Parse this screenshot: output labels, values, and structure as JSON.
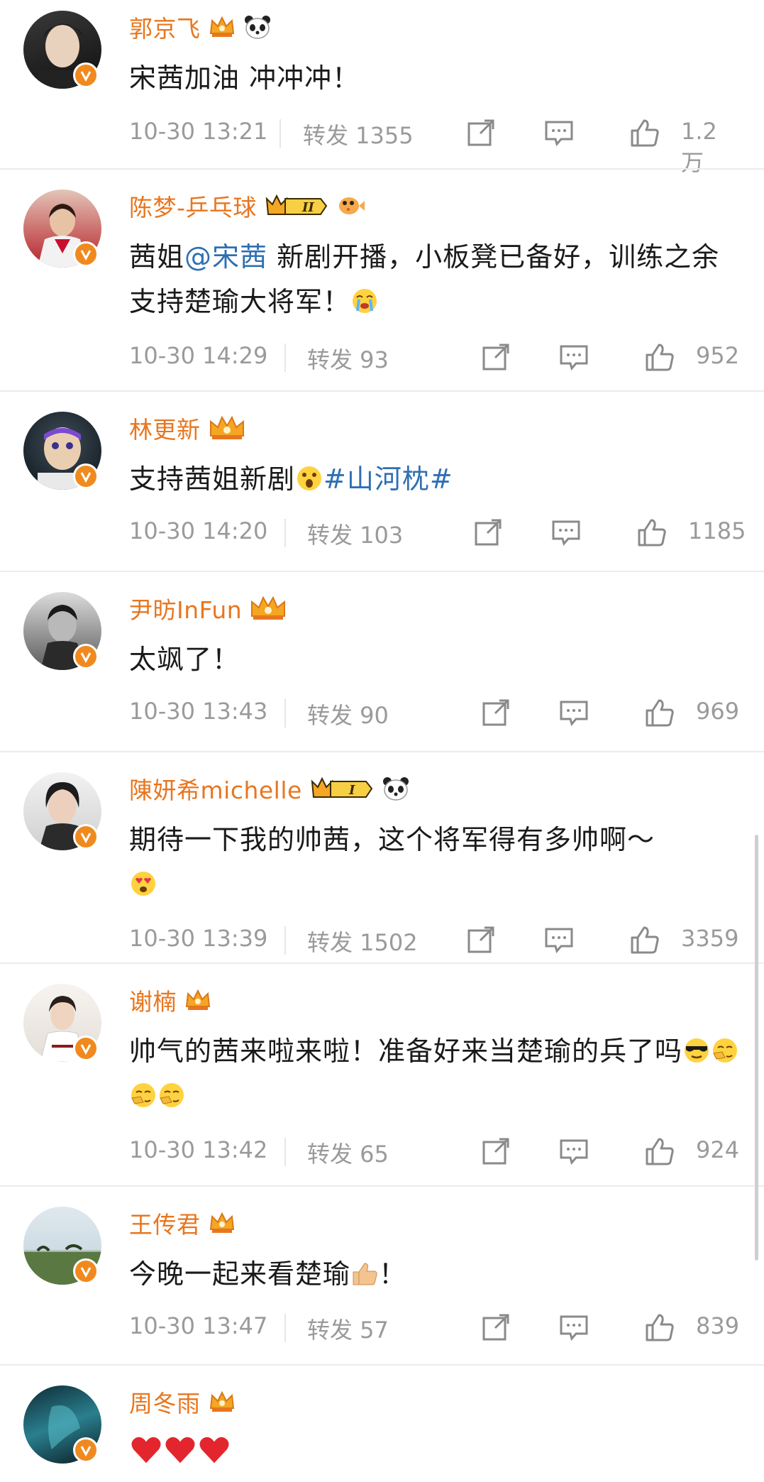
{
  "colors": {
    "name": "#e8761f",
    "link": "#2f6fb3",
    "meta": "#9a9a9a",
    "verified": "#f08a1f"
  },
  "comments": [
    {
      "name": "郭京飞",
      "badges": [
        "crown-icon",
        "panda-icon"
      ],
      "text": "宋茜加油 冲冲冲！",
      "time": "10-30 13:21",
      "repost": "转发 1355",
      "likes": "1.2万"
    },
    {
      "name": "陈梦-乒乓球",
      "badges": [
        "crown-level-badge",
        "pufferfish-icon"
      ],
      "level": "II",
      "text_parts": [
        "茜姐",
        "@宋茜",
        " 新剧开播，小板凳已备好，训练之余支持楚瑜大将军！"
      ],
      "time": "10-30 14:29",
      "repost": "转发 93",
      "likes": "952"
    },
    {
      "name": "林更新",
      "badges": [
        "crown-icon"
      ],
      "text_parts": [
        "支持茜姐新剧",
        "#山河枕#"
      ],
      "time": "10-30 14:20",
      "repost": "转发 103",
      "likes": "1185"
    },
    {
      "name": "尹昉InFun",
      "badges": [
        "crown-icon"
      ],
      "text": "太飒了！",
      "time": "10-30 13:43",
      "repost": "转发 90",
      "likes": "969"
    },
    {
      "name": "陳妍希michelle",
      "badges": [
        "crown-level-badge",
        "panda-icon"
      ],
      "level": "I",
      "text": "期待一下我的帅茜，这个将军得有多帅啊～",
      "time": "10-30 13:39",
      "repost": "转发 1502",
      "likes": "3359"
    },
    {
      "name": "谢楠",
      "badges": [
        "crown-icon"
      ],
      "text": "帅气的茜来啦来啦！准备好来当楚瑜的兵了吗",
      "time": "10-30 13:42",
      "repost": "转发 65",
      "likes": "924"
    },
    {
      "name": "王传君",
      "badges": [
        "crown-icon"
      ],
      "text_parts": [
        "今晚一起来看楚瑜",
        "！"
      ],
      "time": "10-30 13:47",
      "repost": "转发 57",
      "likes": "839"
    },
    {
      "name": "周冬雨",
      "badges": [
        "crown-icon"
      ],
      "text": "",
      "hearts": 3
    }
  ]
}
